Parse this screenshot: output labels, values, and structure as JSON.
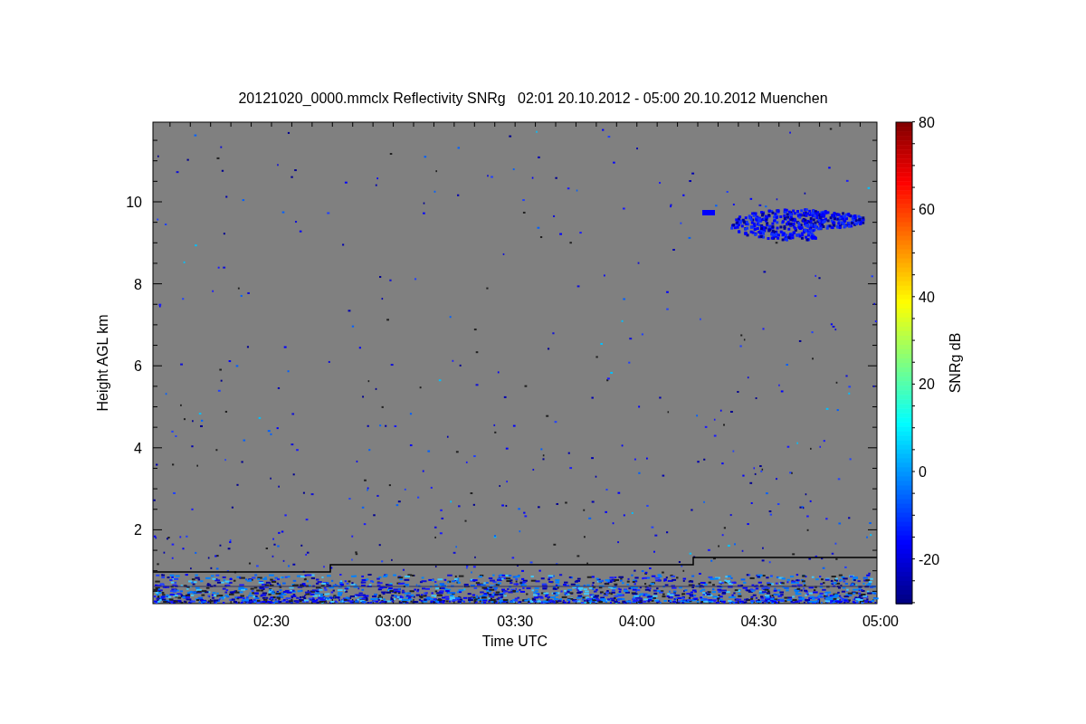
{
  "title": "20121020_0000.mmclx Reflectivity SNRg   02:01 20.10.2012 - 05:00 20.10.2012 Muenchen",
  "y_axis": {
    "label": "Height AGL km",
    "ticks": [
      "10",
      "8",
      "6",
      "4",
      "2"
    ]
  },
  "x_axis": {
    "label": "Time UTC",
    "ticks": [
      "02:30",
      "03:00",
      "03:30",
      "04:00",
      "04:30",
      "05:00"
    ]
  },
  "colorbar": {
    "label": "SNRg dB",
    "ticks": [
      "80",
      "60",
      "40",
      "20",
      "0",
      "-20"
    ]
  }
}
